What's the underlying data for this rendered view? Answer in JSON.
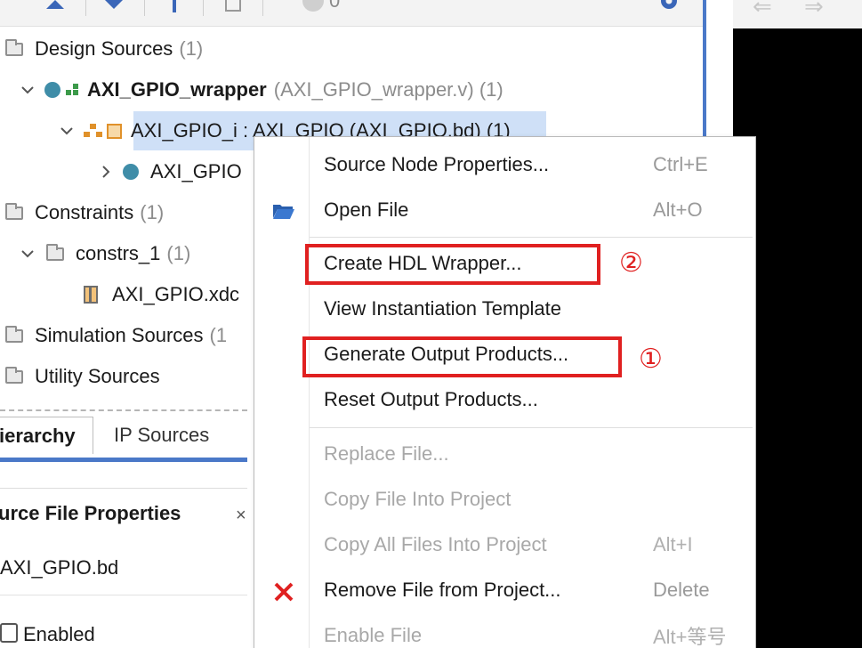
{
  "toolbar": {
    "count": "0"
  },
  "tree": {
    "design_sources": {
      "label": "Design Sources",
      "count": "(1)"
    },
    "wrapper": {
      "name": "AXI_GPIO_wrapper",
      "detail": "(AXI_GPIO_wrapper.v) (1)"
    },
    "instance": {
      "label": "AXI_GPIO_i : AXI_GPIO (AXI_GPIO.bd) (1)"
    },
    "child": {
      "label": "AXI_GPIO"
    },
    "constraints": {
      "label": "Constraints",
      "count": "(1)"
    },
    "constrs": {
      "label": "constrs_1",
      "count": "(1)"
    },
    "xdc": {
      "label": "AXI_GPIO.xdc"
    },
    "simulation": {
      "label": "Simulation Sources",
      "count": "(1"
    },
    "utility": {
      "label": "Utility Sources"
    }
  },
  "tabs": {
    "hierarchy": "ierarchy",
    "ip_sources": "IP Sources"
  },
  "properties": {
    "title": "urce File Properties",
    "close": "×",
    "file": "AXI_GPIO.bd",
    "enabled": "Enabled"
  },
  "menu": {
    "items": [
      {
        "label": "Source Node Properties...",
        "shortcut": "Ctrl+E",
        "icon": ""
      },
      {
        "label": "Open File",
        "shortcut": "Alt+O",
        "icon": "folder-open-icon"
      },
      {
        "label": "Create HDL Wrapper...",
        "shortcut": ""
      },
      {
        "label": "View Instantiation Template",
        "shortcut": ""
      },
      {
        "label": "Generate Output Products...",
        "shortcut": ""
      },
      {
        "label": "Reset Output Products...",
        "shortcut": ""
      },
      {
        "label": "Replace File...",
        "shortcut": "",
        "disabled": true
      },
      {
        "label": "Copy File Into Project",
        "shortcut": "",
        "disabled": true
      },
      {
        "label": "Copy All Files Into Project",
        "shortcut": "Alt+I",
        "disabled": true
      },
      {
        "label": "Remove File from Project...",
        "shortcut": "Delete",
        "icon": "remove-x-icon"
      },
      {
        "label": "Enable File",
        "shortcut": "Alt+等号",
        "disabled": true
      }
    ]
  },
  "annotations": {
    "step1": "①",
    "step2": "②"
  },
  "colors": {
    "accent": "#4a78c8",
    "highlight": "#e02020",
    "selection": "#cfe0f7"
  }
}
